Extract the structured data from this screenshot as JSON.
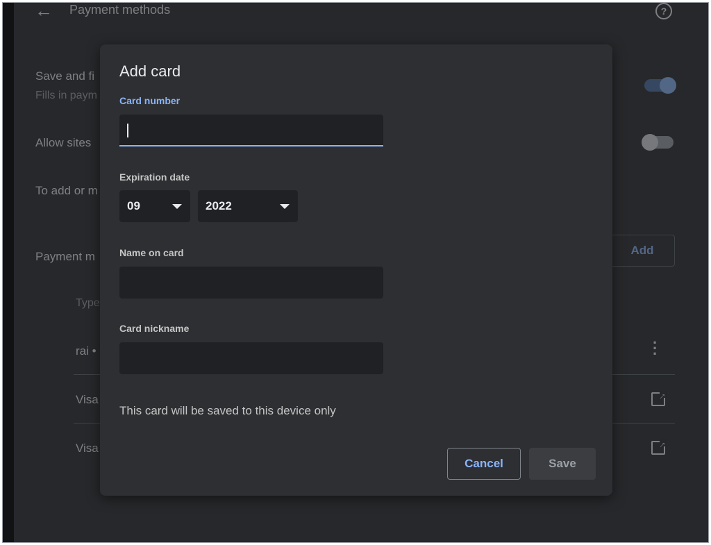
{
  "background": {
    "title": "Payment methods",
    "save_fill_title": "Save and fi",
    "save_fill_sub": "Fills in paym",
    "allow_sites": "Allow sites",
    "to_add": "To add or m",
    "payment_methods_label": "Payment m",
    "add_button": "Add",
    "type_header": "Type",
    "rows": [
      "rai •",
      "Visa",
      "Visa"
    ],
    "toggles": {
      "save_fill": "on",
      "allow_sites": "off"
    }
  },
  "modal": {
    "title": "Add card",
    "card_number_label": "Card number",
    "card_number_value": "",
    "expiration_label": "Expiration date",
    "expiration_month": "09",
    "expiration_year": "2022",
    "name_label": "Name on card",
    "name_value": "",
    "nickname_label": "Card nickname",
    "nickname_value": "",
    "note": "This card will be saved to this device only",
    "cancel_label": "Cancel",
    "save_label": "Save"
  },
  "colors": {
    "accent": "#8ab4f8",
    "surface": "#2e2f33",
    "input_bg": "#202124",
    "text": "#e8eaed"
  },
  "icons": [
    "back-arrow-icon",
    "help-icon",
    "more-vert-icon",
    "open-in-new-icon",
    "dropdown-arrow-icon"
  ]
}
